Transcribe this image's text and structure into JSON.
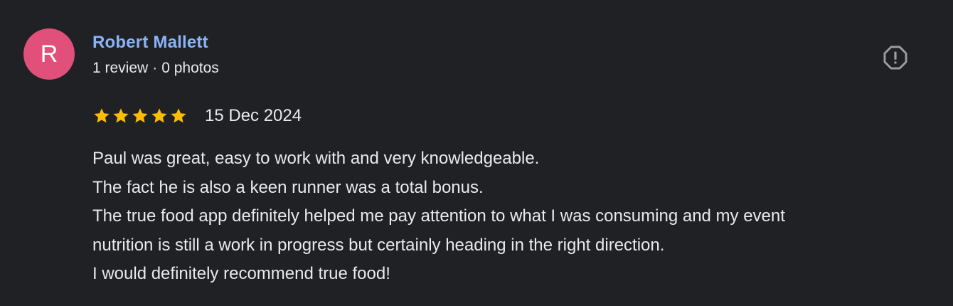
{
  "author": {
    "initial": "R",
    "name": "Robert Mallett",
    "review_count": "1 review",
    "separator": "·",
    "photo_count": "0 photos",
    "avatar_color": "#e0507a"
  },
  "report": {
    "icon": "report-icon"
  },
  "rating": {
    "stars": 5,
    "max_stars": 5,
    "star_color": "#fbbc04",
    "date": "15 Dec 2024"
  },
  "review": {
    "lines": [
      "Paul was great, easy to work with and very knowledgeable.",
      "The fact he is also a keen runner was a total bonus.",
      "The true food app definitely helped me pay attention to what I was consuming and my event",
      "nutrition is still a work in progress but certainly heading in the right direction.",
      "I would definitely recommend true food!"
    ]
  }
}
